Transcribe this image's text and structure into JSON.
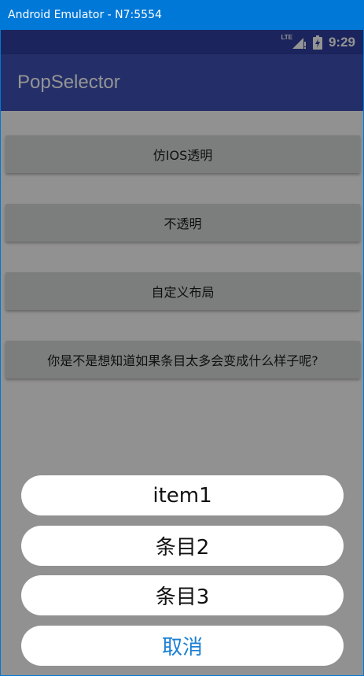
{
  "window": {
    "title": "Android Emulator - N7:5554"
  },
  "status_bar": {
    "network_label": "LTE",
    "time": "9:29"
  },
  "app_bar": {
    "title": "PopSelector"
  },
  "demo_buttons": [
    {
      "label": "仿IOS透明"
    },
    {
      "label": "不透明"
    },
    {
      "label": "自定义布局"
    },
    {
      "label": "你是不是想知道如果条目太多会变成什么样子呢?"
    }
  ],
  "selector": {
    "items": [
      {
        "label": "item1"
      },
      {
        "label": "条目2"
      },
      {
        "label": "条目3"
      }
    ],
    "cancel_label": "取消"
  },
  "colors": {
    "titlebar": "#0078d7",
    "status_bar": "#303F9F",
    "app_bar": "#3F51B5",
    "cancel_text": "#1a7fd4"
  }
}
